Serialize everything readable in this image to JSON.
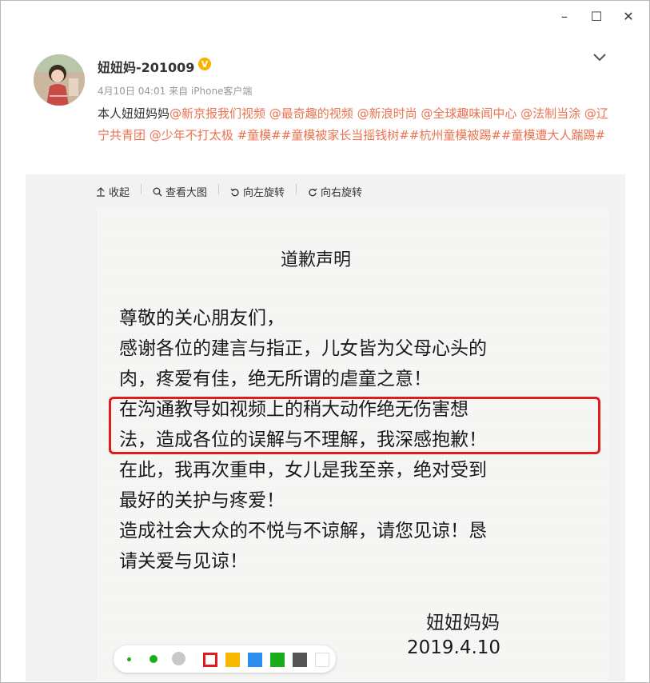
{
  "window_controls": {
    "minimize": "–",
    "maximize": "☐",
    "close": "✕"
  },
  "post": {
    "username": "妞妞妈-201009",
    "verified_badge": "V",
    "meta": "4月10日 04:01 来自 iPhone客户端",
    "text_segments": [
      {
        "text": "本人妞妞妈妈",
        "type": "plain"
      },
      {
        "text": "@新京报我们视频",
        "type": "mention"
      },
      {
        "text": " @最奇趣的视频",
        "type": "mention"
      },
      {
        "text": " @新浪时尚",
        "type": "mention"
      },
      {
        "text": " @全球趣味闻中心 @法制当涂",
        "type": "mention"
      },
      {
        "text": " @辽宁共青团",
        "type": "mention"
      },
      {
        "text": " @少年不打太极",
        "type": "mention"
      },
      {
        "text": " #童模##童模被家长当摇钱树##杭州童模被踢##童模遭大人踹踢#",
        "type": "mention"
      }
    ]
  },
  "toolbar": {
    "collapse_label": "收起",
    "view_large_label": "查看大图",
    "rotate_left_label": "向左旋转",
    "rotate_right_label": "向右旋转"
  },
  "letter": {
    "title": "道歉声明",
    "lines": [
      "尊敬的关心朋友们，",
      "感谢各位的建言与指正，儿女皆为父母心头的",
      "肉，疼爱有佳，绝无所谓的虐童之意！",
      "在沟通教导如视频上的稍大动作绝无伤害想",
      "法，造成各位的误解与不理解，我深感抱歉！",
      "在此，我再次重申，女儿是我至亲，绝对受到",
      "最好的关护与疼爱！",
      "造成社会大众的不悦与不谅解，请您见谅！恳",
      "请关爱与见谅！"
    ],
    "signature": "妞妞妈妈",
    "date": "2019.4.10"
  },
  "colors": {
    "accent": "#eb7350",
    "highlight": "#e01b1b",
    "palette": [
      "#e01b1b",
      "#f9b700",
      "#2c8ff0",
      "#1aac19",
      "#555555",
      "#ffffff"
    ]
  }
}
